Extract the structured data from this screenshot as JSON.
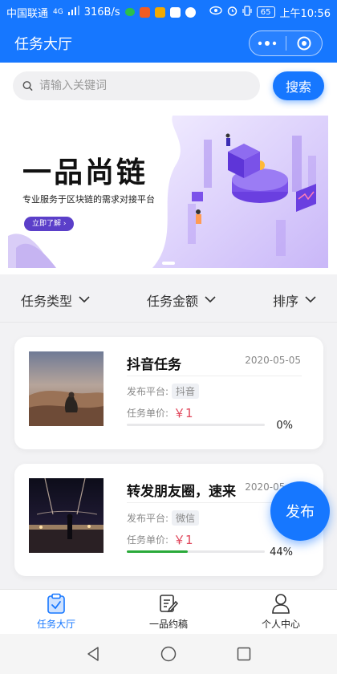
{
  "status_bar": {
    "carrier": "中国联通",
    "network": "4G",
    "speed": "316B/s",
    "battery": "65",
    "time": "上午10:56"
  },
  "header": {
    "title": "任务大厅"
  },
  "search": {
    "placeholder": "请输入关键词",
    "button_label": "搜索"
  },
  "banner": {
    "title": "一品尚链",
    "subtitle": "专业服务于区块链的需求对接平台",
    "cta": "立即了解 ›"
  },
  "filters": [
    {
      "label": "任务类型"
    },
    {
      "label": "任务金额"
    },
    {
      "label": "排序"
    }
  ],
  "tasks": [
    {
      "title": "抖音任务",
      "date": "2020-05-05",
      "platform_label": "发布平台:",
      "platform": "抖音",
      "price_label": "任务单价:",
      "price": "￥1",
      "progress": 0,
      "progress_text": "0%"
    },
    {
      "title": "转发朋友圈，速来",
      "date": "2020-05-05",
      "platform_label": "发布平台:",
      "platform": "微信",
      "price_label": "任务单价:",
      "price": "￥1",
      "progress": 44,
      "progress_text": "44%"
    }
  ],
  "fab": {
    "label": "发布"
  },
  "tabbar": [
    {
      "label": "任务大厅",
      "icon": "clipboard-icon",
      "active": true
    },
    {
      "label": "一品约稿",
      "icon": "edit-note-icon",
      "active": false
    },
    {
      "label": "个人中心",
      "icon": "user-icon",
      "active": false
    }
  ],
  "colors": {
    "primary": "#1677ff",
    "price": "#e0455a",
    "progress": "#2aaa3a"
  }
}
